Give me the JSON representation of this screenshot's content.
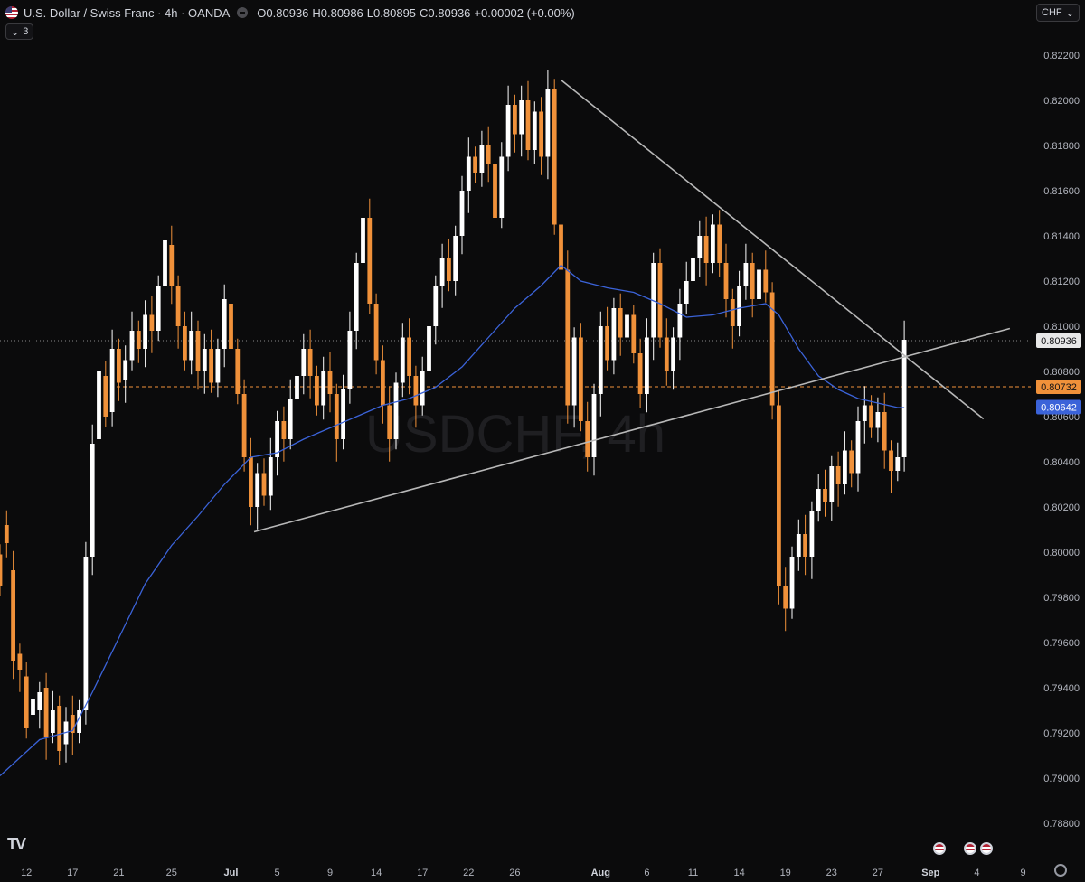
{
  "header": {
    "symbol_title": "U.S. Dollar / Swiss Franc · 4h · OANDA",
    "open_label": "O",
    "open": "0.80936",
    "high_label": "H",
    "high": "0.80986",
    "low_label": "L",
    "low": "0.80895",
    "close_label": "C",
    "close": "0.80936",
    "change": "+0.00002 (+0.00%)",
    "indicators_count": "3",
    "currency": "CHF"
  },
  "watermark": "USDCHF, 4h",
  "colors": {
    "background": "#0b0b0c",
    "up": "#ffffff",
    "down": "#f0913a",
    "ma": "#3b63d9",
    "trendline": "#b8b8b8",
    "axis_text": "#b2b5be"
  },
  "icons": {
    "brand": "tradingview-logo-icon",
    "settings": "gear-icon",
    "event": "us-flag-event-icon"
  },
  "chart_data": {
    "type": "candlestick",
    "title": "U.S. Dollar / Swiss Franc · 4h · OANDA",
    "ylim": [
      0.7875,
      0.8228
    ],
    "y_ticks": [
      "0.82200",
      "0.82000",
      "0.81800",
      "0.81600",
      "0.81400",
      "0.81200",
      "0.81000",
      "0.80800",
      "0.80600",
      "0.80400",
      "0.80200",
      "0.80000",
      "0.79800",
      "0.79600",
      "0.79400",
      "0.79200",
      "0.79000",
      "0.78800"
    ],
    "x_ticks": [
      {
        "label": "12",
        "index": 4
      },
      {
        "label": "17",
        "index": 11
      },
      {
        "label": "21",
        "index": 18
      },
      {
        "label": "25",
        "index": 26
      },
      {
        "label": "Jul",
        "index": 35
      },
      {
        "label": "5",
        "index": 42
      },
      {
        "label": "9",
        "index": 50
      },
      {
        "label": "14",
        "index": 57
      },
      {
        "label": "17",
        "index": 64
      },
      {
        "label": "22",
        "index": 71
      },
      {
        "label": "26",
        "index": 78
      },
      {
        "label": "Aug",
        "index": 91
      },
      {
        "label": "6",
        "index": 98
      },
      {
        "label": "11",
        "index": 105
      },
      {
        "label": "14",
        "index": 112
      },
      {
        "label": "19",
        "index": 119
      },
      {
        "label": "23",
        "index": 126
      },
      {
        "label": "27",
        "index": 133
      },
      {
        "label": "Sep",
        "index": 141
      },
      {
        "label": "4",
        "index": 148
      },
      {
        "label": "9",
        "index": 155
      }
    ],
    "price_labels": [
      {
        "value": "0.80936",
        "price": 0.80936,
        "style": "last"
      },
      {
        "value": "0.80732",
        "price": 0.80732,
        "style": "level"
      },
      {
        "value": "0.80642",
        "price": 0.80642,
        "style": "ma"
      }
    ],
    "horizontal_level": 0.80732,
    "trendlines": [
      {
        "from": {
          "index": 38.5,
          "price": 0.8009
        },
        "to": {
          "index": 153,
          "price": 0.8099
        }
      },
      {
        "from": {
          "index": 85,
          "price": 0.8209
        },
        "to": {
          "index": 149,
          "price": 0.8059
        }
      }
    ],
    "ohlc_points": [
      [
        0,
        0.7999,
        0.7985
      ],
      [
        1,
        0.8012,
        0.8004
      ],
      [
        2,
        0.7992,
        0.7952
      ],
      [
        3,
        0.7955,
        0.7948
      ],
      [
        4,
        0.7945,
        0.7922
      ],
      [
        5,
        0.7928,
        0.7935
      ],
      [
        6,
        0.793,
        0.7938
      ],
      [
        7,
        0.794,
        0.7918
      ],
      [
        8,
        0.792,
        0.793
      ],
      [
        9,
        0.7932,
        0.7912
      ],
      [
        10,
        0.7915,
        0.7925
      ],
      [
        11,
        0.7928,
        0.792
      ],
      [
        12,
        0.792,
        0.793
      ],
      [
        13,
        0.793,
        0.7998
      ],
      [
        14,
        0.7998,
        0.8048
      ],
      [
        15,
        0.805,
        0.808
      ],
      [
        16,
        0.8078,
        0.806
      ],
      [
        17,
        0.8062,
        0.809
      ],
      [
        18,
        0.809,
        0.8075
      ],
      [
        19,
        0.8076,
        0.8085
      ],
      [
        20,
        0.8085,
        0.8098
      ],
      [
        21,
        0.8098,
        0.809
      ],
      [
        22,
        0.809,
        0.8105
      ],
      [
        23,
        0.8105,
        0.8098
      ],
      [
        24,
        0.8098,
        0.8118
      ],
      [
        25,
        0.8118,
        0.8138
      ],
      [
        26,
        0.8136,
        0.8118
      ],
      [
        27,
        0.8118,
        0.81
      ],
      [
        28,
        0.81,
        0.8085
      ],
      [
        29,
        0.8085,
        0.8098
      ],
      [
        30,
        0.8098,
        0.808
      ],
      [
        31,
        0.808,
        0.809
      ],
      [
        32,
        0.809,
        0.8075
      ],
      [
        33,
        0.8075,
        0.809
      ],
      [
        34,
        0.809,
        0.8112
      ],
      [
        35,
        0.811,
        0.809
      ],
      [
        36,
        0.809,
        0.807
      ],
      [
        37,
        0.807,
        0.8042
      ],
      [
        38,
        0.8042,
        0.802
      ],
      [
        39,
        0.802,
        0.8035
      ],
      [
        40,
        0.8035,
        0.8025
      ],
      [
        41,
        0.8025,
        0.8042
      ],
      [
        42,
        0.8042,
        0.8058
      ],
      [
        43,
        0.8058,
        0.805
      ],
      [
        44,
        0.805,
        0.8068
      ],
      [
        45,
        0.8068,
        0.8078
      ],
      [
        46,
        0.8078,
        0.809
      ],
      [
        47,
        0.809,
        0.8078
      ],
      [
        48,
        0.8078,
        0.8065
      ],
      [
        49,
        0.8065,
        0.808
      ],
      [
        50,
        0.808,
        0.807
      ],
      [
        51,
        0.807,
        0.805
      ],
      [
        52,
        0.805,
        0.8072
      ],
      [
        53,
        0.8072,
        0.8098
      ],
      [
        54,
        0.8098,
        0.8128
      ],
      [
        55,
        0.8128,
        0.8148
      ],
      [
        56,
        0.8148,
        0.811
      ],
      [
        57,
        0.811,
        0.8085
      ],
      [
        58,
        0.8085,
        0.8065
      ],
      [
        59,
        0.8065,
        0.805
      ],
      [
        60,
        0.805,
        0.8075
      ],
      [
        61,
        0.8075,
        0.8095
      ],
      [
        62,
        0.8095,
        0.8078
      ],
      [
        63,
        0.8078,
        0.8065
      ],
      [
        64,
        0.8065,
        0.808
      ],
      [
        65,
        0.808,
        0.81
      ],
      [
        66,
        0.81,
        0.8118
      ],
      [
        67,
        0.8118,
        0.813
      ],
      [
        68,
        0.813,
        0.812
      ],
      [
        69,
        0.812,
        0.814
      ],
      [
        70,
        0.814,
        0.816
      ],
      [
        71,
        0.816,
        0.8175
      ],
      [
        72,
        0.8175,
        0.8168
      ],
      [
        73,
        0.8168,
        0.818
      ],
      [
        74,
        0.818,
        0.8172
      ],
      [
        75,
        0.8172,
        0.8148
      ],
      [
        76,
        0.8148,
        0.8175
      ],
      [
        77,
        0.8175,
        0.8198
      ],
      [
        78,
        0.8198,
        0.8185
      ],
      [
        79,
        0.8185,
        0.82
      ],
      [
        80,
        0.82,
        0.8178
      ],
      [
        81,
        0.8178,
        0.8195
      ],
      [
        82,
        0.8195,
        0.8175
      ],
      [
        83,
        0.8175,
        0.8205
      ],
      [
        84,
        0.8205,
        0.8145
      ],
      [
        85,
        0.8145,
        0.8125
      ],
      [
        86,
        0.8125,
        0.8065
      ],
      [
        87,
        0.8065,
        0.8095
      ],
      [
        88,
        0.8095,
        0.8058
      ],
      [
        89,
        0.8058,
        0.8042
      ],
      [
        90,
        0.8042,
        0.807
      ],
      [
        91,
        0.807,
        0.81
      ],
      [
        92,
        0.81,
        0.8085
      ],
      [
        93,
        0.8085,
        0.8108
      ],
      [
        94,
        0.8108,
        0.8095
      ],
      [
        95,
        0.8095,
        0.8105
      ],
      [
        96,
        0.8105,
        0.8088
      ],
      [
        97,
        0.8088,
        0.807
      ],
      [
        98,
        0.807,
        0.8095
      ],
      [
        99,
        0.8095,
        0.8128
      ],
      [
        100,
        0.8128,
        0.8095
      ],
      [
        101,
        0.8095,
        0.808
      ],
      [
        102,
        0.808,
        0.8095
      ],
      [
        103,
        0.8095,
        0.811
      ],
      [
        104,
        0.811,
        0.812
      ],
      [
        105,
        0.812,
        0.813
      ],
      [
        106,
        0.813,
        0.814
      ],
      [
        107,
        0.814,
        0.8128
      ],
      [
        108,
        0.8128,
        0.8145
      ],
      [
        109,
        0.8145,
        0.8128
      ],
      [
        110,
        0.8128,
        0.8112
      ],
      [
        111,
        0.8112,
        0.81
      ],
      [
        112,
        0.81,
        0.8118
      ],
      [
        113,
        0.8118,
        0.8128
      ],
      [
        114,
        0.8128,
        0.8112
      ],
      [
        115,
        0.8112,
        0.8125
      ],
      [
        116,
        0.8125,
        0.8115
      ],
      [
        117,
        0.8115,
        0.8065
      ],
      [
        118,
        0.8065,
        0.7985
      ],
      [
        119,
        0.7985,
        0.7975
      ],
      [
        120,
        0.7975,
        0.7998
      ],
      [
        121,
        0.7998,
        0.8008
      ],
      [
        122,
        0.8008,
        0.7998
      ],
      [
        123,
        0.7998,
        0.8018
      ],
      [
        124,
        0.8018,
        0.8028
      ],
      [
        125,
        0.8028,
        0.8022
      ],
      [
        126,
        0.8022,
        0.8038
      ],
      [
        127,
        0.8038,
        0.803
      ],
      [
        128,
        0.803,
        0.8045
      ],
      [
        129,
        0.8045,
        0.8035
      ],
      [
        130,
        0.8035,
        0.8058
      ],
      [
        131,
        0.8058,
        0.8065
      ],
      [
        132,
        0.8065,
        0.8055
      ],
      [
        133,
        0.8055,
        0.8062
      ],
      [
        134,
        0.8062,
        0.8045
      ],
      [
        135,
        0.8045,
        0.8036
      ],
      [
        136,
        0.8036,
        0.8042
      ],
      [
        137,
        0.8042,
        0.8094
      ]
    ],
    "ma_series": [
      [
        0,
        0.7901
      ],
      [
        6,
        0.7917
      ],
      [
        11,
        0.7921
      ],
      [
        14,
        0.7938
      ],
      [
        18,
        0.7962
      ],
      [
        22,
        0.7986
      ],
      [
        26,
        0.8003
      ],
      [
        30,
        0.8016
      ],
      [
        34,
        0.803
      ],
      [
        38,
        0.8042
      ],
      [
        42,
        0.8044
      ],
      [
        46,
        0.805
      ],
      [
        50,
        0.8055
      ],
      [
        54,
        0.806
      ],
      [
        58,
        0.8065
      ],
      [
        62,
        0.8068
      ],
      [
        66,
        0.8073
      ],
      [
        70,
        0.8082
      ],
      [
        74,
        0.8095
      ],
      [
        78,
        0.8108
      ],
      [
        82,
        0.8118
      ],
      [
        85,
        0.8127
      ],
      [
        88,
        0.812
      ],
      [
        92,
        0.8117
      ],
      [
        96,
        0.8115
      ],
      [
        100,
        0.811
      ],
      [
        104,
        0.8104
      ],
      [
        108,
        0.8105
      ],
      [
        112,
        0.8108
      ],
      [
        116,
        0.811
      ],
      [
        118,
        0.8105
      ],
      [
        121,
        0.809
      ],
      [
        124,
        0.8078
      ],
      [
        127,
        0.8072
      ],
      [
        130,
        0.8068
      ],
      [
        133,
        0.8066
      ],
      [
        136,
        0.8064
      ],
      [
        137,
        0.8064
      ]
    ]
  }
}
